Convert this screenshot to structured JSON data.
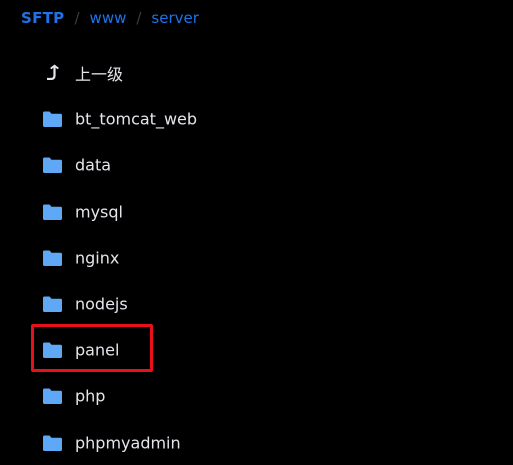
{
  "breadcrumb": {
    "root": "SFTP",
    "separator": "/",
    "items": [
      "www",
      "server"
    ]
  },
  "colors": {
    "background": "#000000",
    "accent": "#1e73e8",
    "folder": "#5fa8f5",
    "text": "#e4e6eb",
    "highlight": "#e8101a"
  },
  "list": {
    "parent": {
      "label": "上一级",
      "icon": "arrow-up-icon"
    },
    "folders": [
      {
        "label": "bt_tomcat_web",
        "icon": "folder-icon"
      },
      {
        "label": "data",
        "icon": "folder-icon"
      },
      {
        "label": "mysql",
        "icon": "folder-icon"
      },
      {
        "label": "nginx",
        "icon": "folder-icon"
      },
      {
        "label": "nodejs",
        "icon": "folder-icon"
      },
      {
        "label": "panel",
        "icon": "folder-icon",
        "highlighted": true
      },
      {
        "label": "php",
        "icon": "folder-icon"
      },
      {
        "label": "phpmyadmin",
        "icon": "folder-icon"
      }
    ]
  }
}
